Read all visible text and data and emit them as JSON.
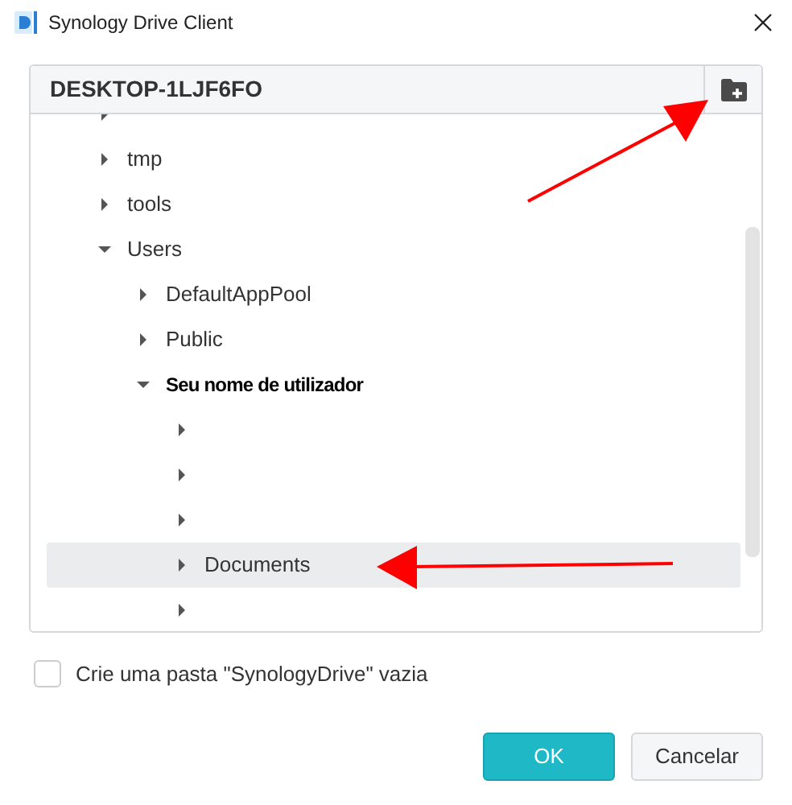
{
  "window": {
    "title": "Synology Drive Client"
  },
  "panel": {
    "title": "DESKTOP-1LJF6FO"
  },
  "tree": [
    {
      "expanded": false
    },
    {
      "label": "tmp",
      "expanded": false
    },
    {
      "label": "tools",
      "expanded": false
    },
    {
      "label": "Users",
      "expanded": true,
      "children": [
        {
          "label": "DefaultAppPool",
          "expanded": false
        },
        {
          "label": "Public",
          "expanded": false
        },
        {
          "label": "Seu nome de utilizador",
          "bold": true,
          "expanded": true,
          "children": [
            {
              "expanded": false
            },
            {
              "expanded": false
            },
            {
              "expanded": false
            },
            {
              "label": "Documents",
              "expanded": false,
              "selected": true
            },
            {
              "expanded": false
            }
          ]
        }
      ]
    }
  ],
  "checkbox": {
    "label": "Crie uma pasta \"SynologyDrive\" vazia",
    "checked": false
  },
  "buttons": [
    {
      "label": "OK",
      "kind": "primary"
    },
    {
      "label": "Cancelar",
      "kind": "secondary"
    }
  ]
}
